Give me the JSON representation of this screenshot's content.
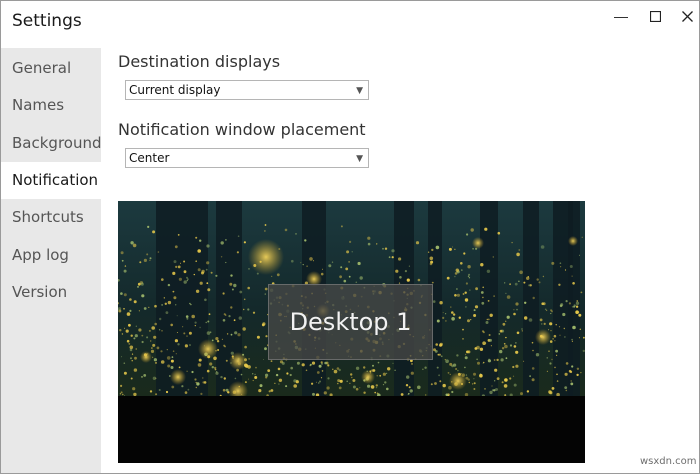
{
  "window": {
    "title": "Settings"
  },
  "sidebar": {
    "items": [
      {
        "label": "General"
      },
      {
        "label": "Names"
      },
      {
        "label": "Background"
      },
      {
        "label": "Notification",
        "active": true
      },
      {
        "label": "Shortcuts"
      },
      {
        "label": "App log"
      },
      {
        "label": "Version"
      }
    ]
  },
  "main": {
    "destination": {
      "label": "Destination displays",
      "value": "Current display"
    },
    "placement": {
      "label": "Notification window placement",
      "value": "Center"
    },
    "preview": {
      "notification_text": "Desktop 1"
    }
  },
  "watermark": "wsxdn.com"
}
